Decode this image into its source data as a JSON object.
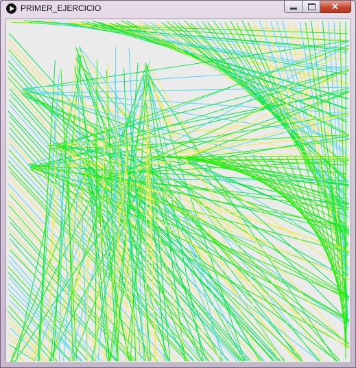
{
  "window": {
    "title": "PRIMER_EJERCICIO",
    "app_icon": "play-icon",
    "controls": {
      "minimize_icon": "minimize-icon",
      "maximize_icon": "maximize-icon",
      "close_icon": "close-icon"
    }
  },
  "sketch": {
    "background": "#ebebeb",
    "colors": [
      "#00e84a",
      "#4fd8f0",
      "#f2ea4a",
      "#22f000"
    ]
  }
}
